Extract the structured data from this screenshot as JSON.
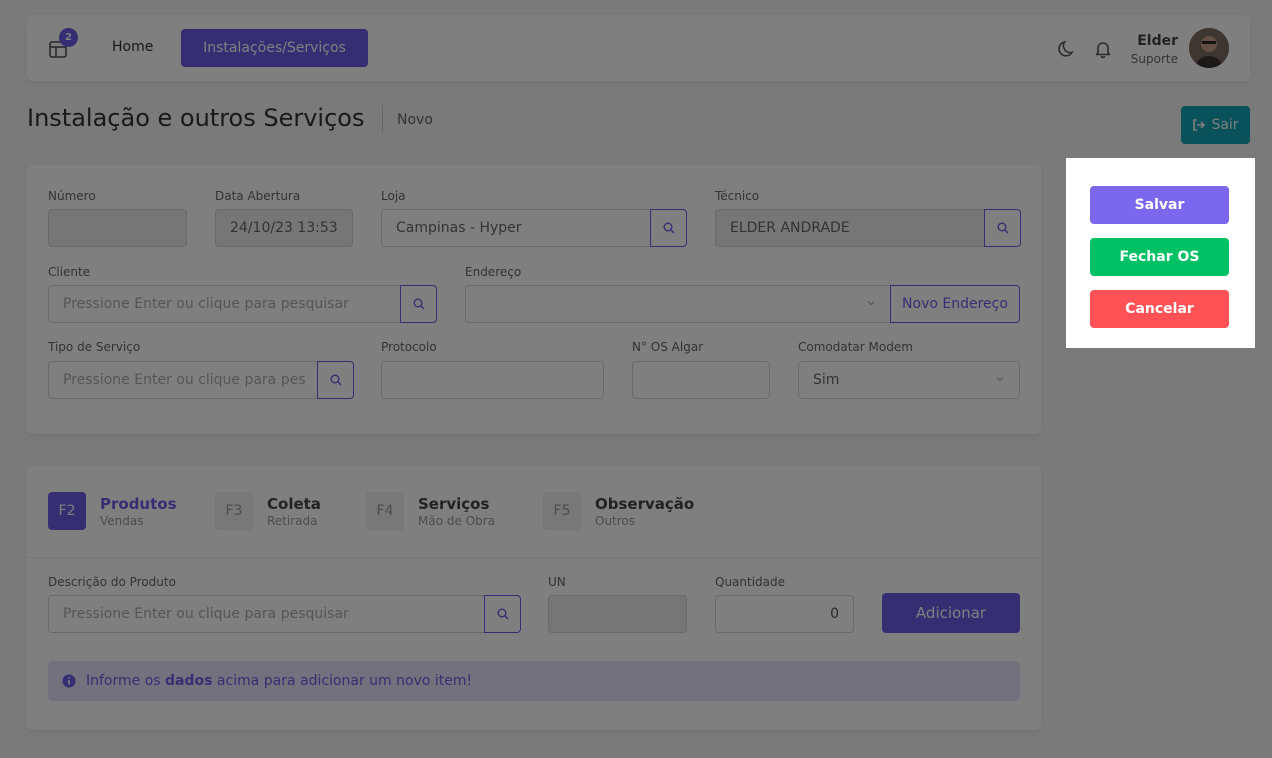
{
  "navbar": {
    "badge_count": "2",
    "home_label": "Home",
    "active_label": "Instalações/Serviços",
    "user_name": "Elder",
    "user_role": "Suporte"
  },
  "page": {
    "title": "Instalação e outros Serviços",
    "subtitle": "Novo",
    "exit_label": "Sair"
  },
  "form": {
    "numero_label": "Número",
    "numero_value": "",
    "data_label": "Data Abertura",
    "data_value": "24/10/23 13:53",
    "loja_label": "Loja",
    "loja_value": "Campinas - Hyper",
    "tecnico_label": "Técnico",
    "tecnico_value": "ELDER ANDRADE",
    "cliente_label": "Cliente",
    "cliente_placeholder": "Pressione Enter ou clique para pesquisar",
    "endereco_label": "Endereço",
    "endereco_value": "",
    "novo_endereco_label": "Novo Endereço",
    "tipo_label": "Tipo de Serviço",
    "tipo_placeholder": "Pressione Enter ou clique para pes",
    "protocolo_label": "Protocolo",
    "protocolo_value": "",
    "os_label": "N° OS Algar",
    "os_value": "",
    "comodatar_label": "Comodatar Modem",
    "comodatar_value": "Sim"
  },
  "tabs": [
    {
      "key": "F2",
      "title": "Produtos",
      "sub": "Vendas"
    },
    {
      "key": "F3",
      "title": "Coleta",
      "sub": "Retirada"
    },
    {
      "key": "F4",
      "title": "Serviços",
      "sub": "Mão de Obra"
    },
    {
      "key": "F5",
      "title": "Observação",
      "sub": "Outros"
    }
  ],
  "items": {
    "descricao_label": "Descrição do Produto",
    "descricao_placeholder": "Pressione Enter ou clique para pesquisar",
    "un_label": "UN",
    "un_value": "",
    "qtd_label": "Quantidade",
    "qtd_value": "0",
    "add_label": "Adicionar",
    "alert_pre": "Informe os ",
    "alert_bold": "dados",
    "alert_post": " acima para adicionar um novo item!"
  },
  "popup": {
    "save_label": "Salvar",
    "close_os_label": "Fechar OS",
    "cancel_label": "Cancelar"
  },
  "colors": {
    "accent": "#6b5ce7",
    "save": "#7b68ee",
    "close_os": "#00c264",
    "cancel": "#ff5257",
    "exit": "#12a3b6"
  }
}
